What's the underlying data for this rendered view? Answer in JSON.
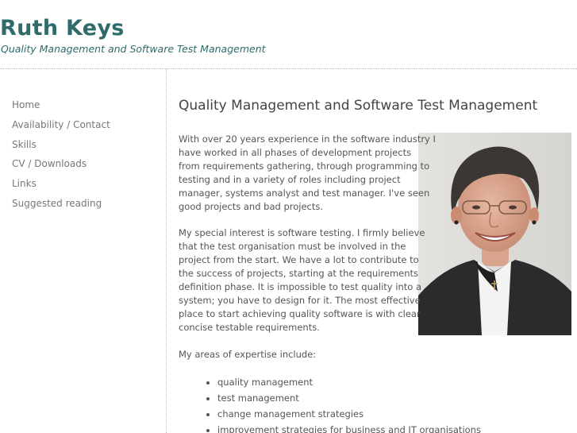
{
  "header": {
    "title": "Ruth Keys",
    "tagline": "Quality Management and Software Test Management"
  },
  "nav": {
    "items": [
      {
        "label": "Home"
      },
      {
        "label": "Availability / Contact"
      },
      {
        "label": "Skills"
      },
      {
        "label": "CV / Downloads"
      },
      {
        "label": "Links"
      },
      {
        "label": "Suggested reading"
      }
    ]
  },
  "main": {
    "title": "Quality Management and Software Test Management",
    "intro_lines": [
      "With over 20 years experience in the software industry I",
      "have worked in all phases of development projects",
      "from requirements gathering, through programming to",
      "testing and in a variety of roles including project",
      "manager, systems analyst and test manager. I've seen",
      "good projects and bad projects."
    ],
    "testing_lines": [
      "My special interest is software testing. I firmly believe",
      "that the test organisation must be involved in the",
      "project from the start. We have a lot to contribute to",
      "the success of projects, starting at the requirements",
      "definition phase. It is impossible to test quality into a",
      "system; you have to design for it. The most effective",
      "place to start achieving quality software is with clear",
      "concise testable requirements."
    ],
    "expertise_intro": "My areas of expertise include:",
    "expertise": [
      "quality management",
      "test management",
      "change management strategies",
      "improvement strategies for business and IT organisations"
    ]
  }
}
